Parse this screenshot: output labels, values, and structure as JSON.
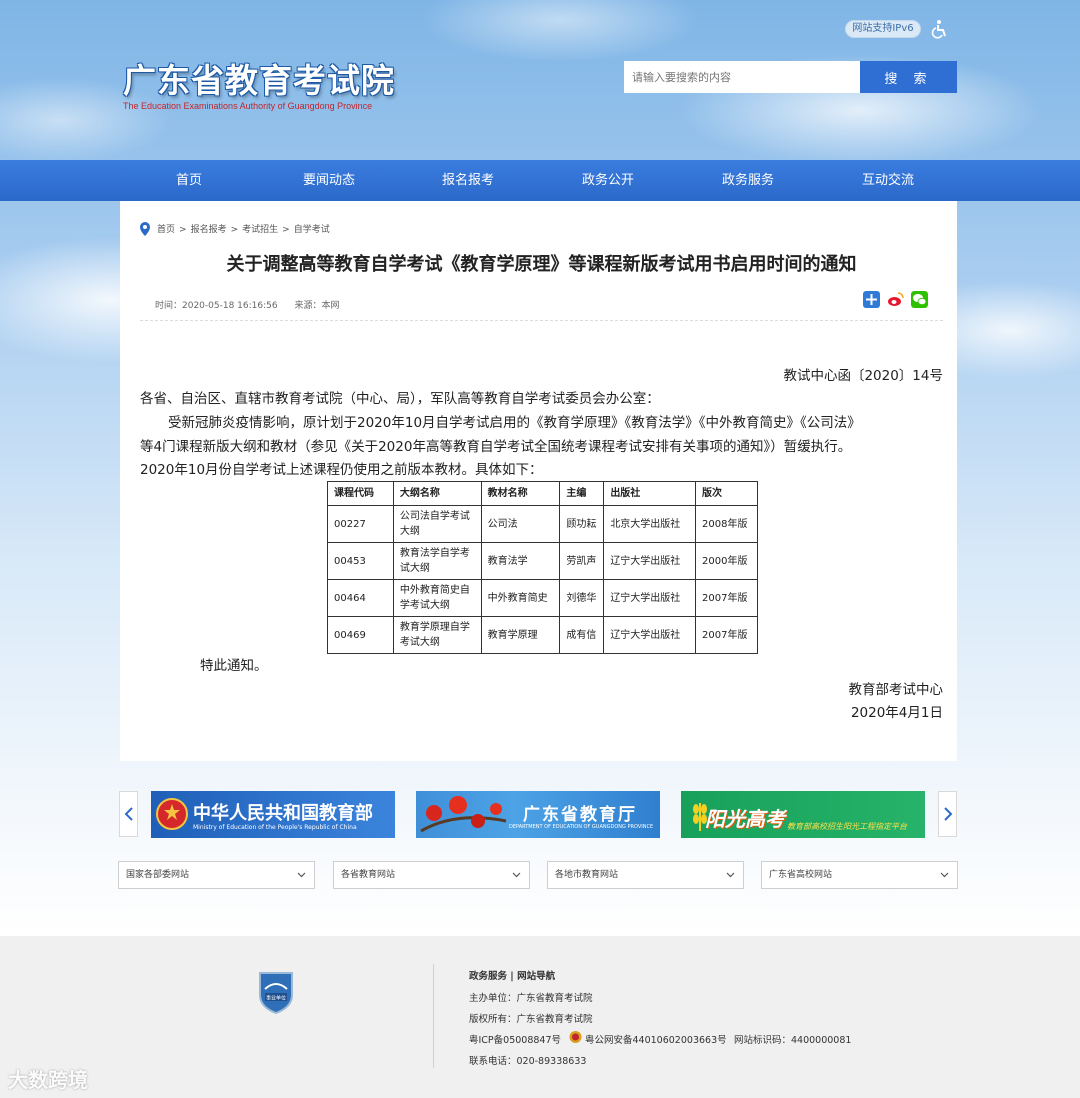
{
  "header": {
    "site_title": "广东省教育考试院",
    "site_title_en": "The Education Examinations Authority of Guangdong Province",
    "ipv6_badge": "网站支持IPv6",
    "search_placeholder": "请输入要搜索的内容",
    "search_button": "搜 索"
  },
  "nav": [
    "首页",
    "要闻动态",
    "报名报考",
    "政务公开",
    "政务服务",
    "互动交流"
  ],
  "breadcrumb": [
    "首页",
    ">",
    "报名报考",
    ">",
    "考试招生",
    ">",
    "自学考试"
  ],
  "article": {
    "title": "关于调整高等教育自学考试《教育学原理》等课程新版考试用书启用时间的通知",
    "time": "时间：2020-05-18 16:16:56",
    "source": "来源：本网",
    "doc_no": "教试中心函〔2020〕14号",
    "salutation": "各省、自治区、直辖市教育考试院（中心、局），军队高等教育自学考试委员会办公室：",
    "body_line1": "受新冠肺炎疫情影响，原计划于2020年10月自学考试启用的《教育学原理》《教育法学》《中外教育简史》《公司法》",
    "body_line2": "等4门课程新版大纲和教材（参见《关于2020年高等教育自学考试全国统考课程考试安排有关事项的通知》）暂缓执行。",
    "body_line3": "2020年10月份自学考试上述课程仍使用之前版本教材。具体如下：",
    "notice": "特此通知。",
    "signer": "教育部考试中心",
    "date": "2020年4月1日",
    "table": {
      "headers": [
        "课程代码",
        "大纲名称",
        "教材名称",
        "主编",
        "出版社",
        "版次"
      ],
      "rows": [
        [
          "00227",
          "公司法自学考试大纲",
          "公司法",
          "顾功耘",
          "北京大学出版社",
          "2008年版"
        ],
        [
          "00453",
          "教育法学自学考试大纲",
          "教育法学",
          "劳凯声",
          "辽宁大学出版社",
          "2000年版"
        ],
        [
          "00464",
          "中外教育简史自学考试大纲",
          "中外教育简史",
          "刘德华",
          "辽宁大学出版社",
          "2007年版"
        ],
        [
          "00469",
          "教育学原理自学考试大纲",
          "教育学原理",
          "成有信",
          "辽宁大学出版社",
          "2007年版"
        ]
      ]
    }
  },
  "banners": {
    "moe": {
      "title": "中华人民共和国教育部",
      "subtitle": "Ministry of Education of the People's Republic of China"
    },
    "gd": {
      "title": "广东省教育厅",
      "subtitle": "DEPARTMENT OF EDUCATION OF GUANGDONG PROVINCE"
    },
    "sunshine": {
      "title": "阳光高考",
      "subtitle": "教育部高校招生阳光工程指定平台"
    }
  },
  "selects": [
    "国家各部委网站",
    "各省教育网站",
    "各地市教育网站",
    "广东省高校网站"
  ],
  "footer": {
    "links": "政务服务 | 网站导航",
    "host": "主办单位：广东省教育考试院",
    "copyright": "版权所有：广东省教育考试院",
    "icp": "粤ICP备05008847号",
    "police": "粤公网安备44010602003663号",
    "site_code": "网站标识码：4400000081",
    "phone": "联系电话：020-89338633",
    "emblem_text": "事业单位"
  },
  "watermark": "大数跨境",
  "colors": {
    "nav_blue": "#2f6ed3",
    "title_red": "#c0262b",
    "moe_blue": "#2b6fc9",
    "sunshine_green": "#1fa05a"
  }
}
